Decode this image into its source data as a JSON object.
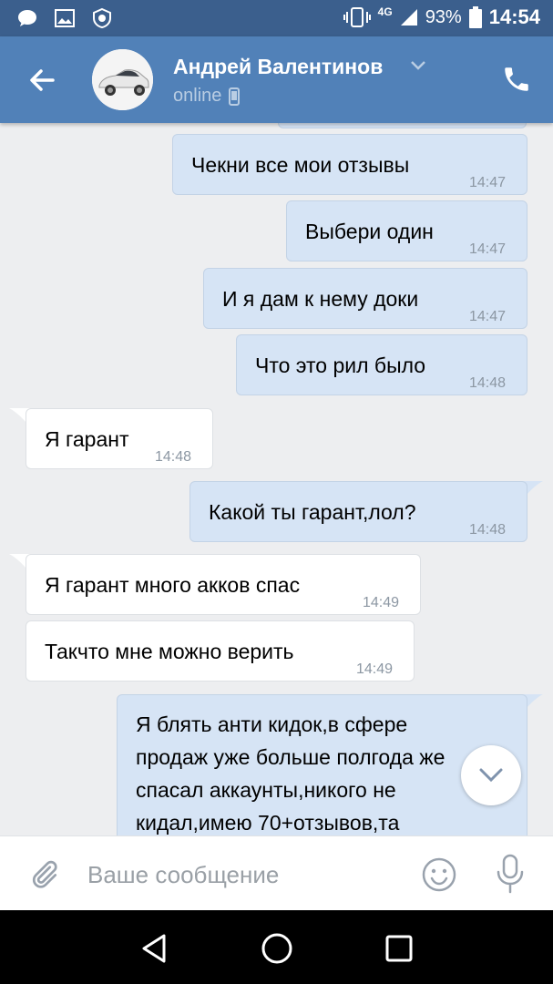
{
  "status_bar": {
    "network": "4G",
    "battery_percent": "93%",
    "clock": "14:54"
  },
  "header": {
    "contact_name": "Андрей Валентинов",
    "contact_status": "online"
  },
  "messages": [
    {
      "direction": "out",
      "text": "Чекни все мои отзывы",
      "time": "14:47"
    },
    {
      "direction": "out",
      "text": "Выбери один",
      "time": "14:47"
    },
    {
      "direction": "out",
      "text": "И я дам к нему доки",
      "time": "14:47"
    },
    {
      "direction": "out",
      "text": "Что это рил было",
      "time": "14:48"
    },
    {
      "direction": "in",
      "text": "Я гарант",
      "time": "14:48"
    },
    {
      "direction": "out",
      "text": "Какой ты гарант,лол?",
      "time": "14:48"
    },
    {
      "direction": "in",
      "text": "Я гарант много акков спас",
      "time": "14:49"
    },
    {
      "direction": "in",
      "text": "Такчто мне можно верить",
      "time": "14:49"
    },
    {
      "direction": "out",
      "text": "Я блять анти кидок,в сфере продаж уже больше полгода же спасал аккаунты,никого не кидал,имею 70+отзывов,та",
      "time": ""
    }
  ],
  "composer": {
    "placeholder": "Ваше сообщение"
  },
  "icons": {
    "back": "arrow-left-icon",
    "call": "phone-icon",
    "attach": "paperclip-icon",
    "emoji": "smiley-icon",
    "mic": "microphone-icon",
    "scroll_down": "chevron-down-icon"
  },
  "colors": {
    "status_bar": "#3b5f8d",
    "header": "#5181b8",
    "outgoing_bubble": "#d6e4f5",
    "incoming_bubble": "#ffffff",
    "chat_background": "#edeef0"
  }
}
